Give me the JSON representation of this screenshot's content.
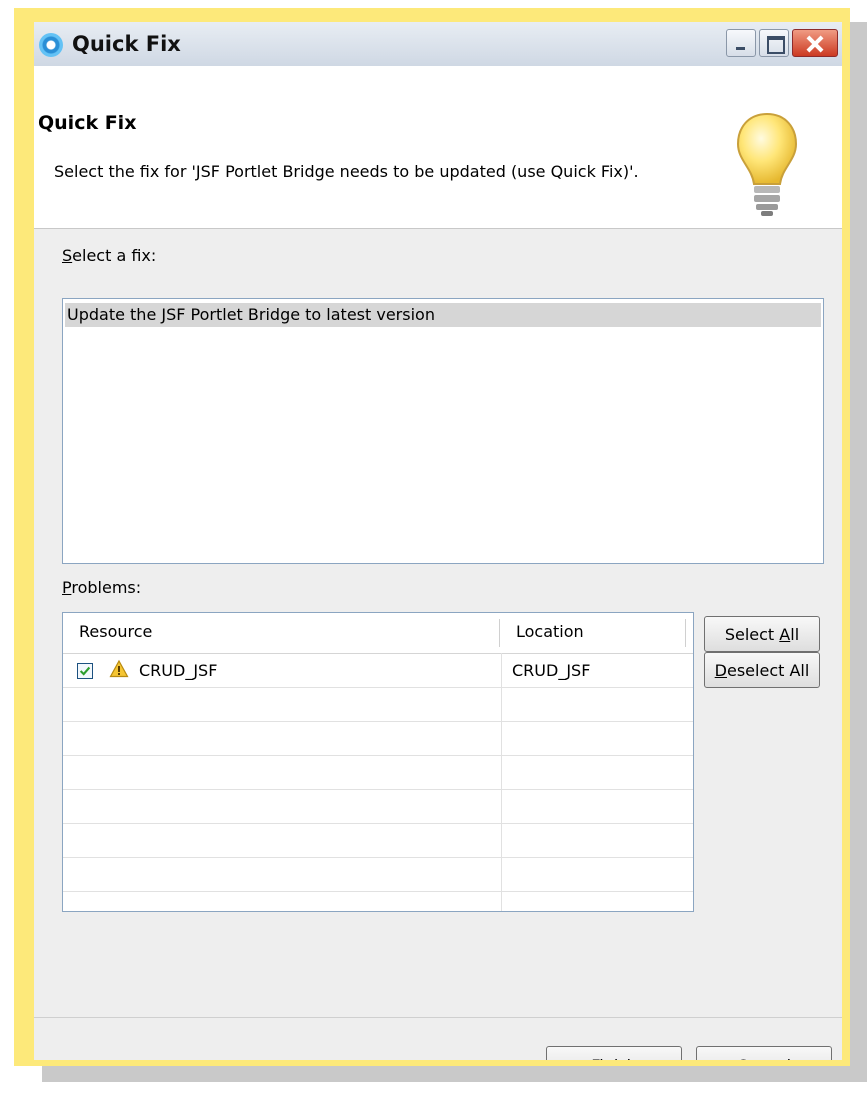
{
  "window": {
    "title": "Quick Fix"
  },
  "header": {
    "title": "Quick Fix",
    "description": "Select the fix for 'JSF Portlet Bridge needs to be updated (use Quick Fix)'."
  },
  "fixes": {
    "label_mnemonic": "S",
    "label_rest": "elect a fix:",
    "items": [
      "Update the JSF Portlet Bridge to latest version"
    ]
  },
  "problems": {
    "label_mnemonic": "P",
    "label_rest": "roblems:",
    "columns": [
      "Resource",
      "Location"
    ],
    "rows": [
      {
        "resource": "CRUD_JSF",
        "location": "CRUD_JSF",
        "checked": true,
        "icon": "warning-icon"
      }
    ]
  },
  "buttons": {
    "select_all_prefix": "Select ",
    "select_all_mnemonic": "A",
    "select_all_suffix": "ll",
    "deselect_all_mnemonic": "D",
    "deselect_all_rest": "eselect All",
    "finish_mnemonic": "F",
    "finish_rest": "inish",
    "cancel": "Cancel"
  },
  "icons": {
    "help": "?"
  },
  "colors": {
    "highlight_frame": "#fde97a",
    "selection": "#d6d6d6",
    "list_border": "#8ba5c1"
  }
}
